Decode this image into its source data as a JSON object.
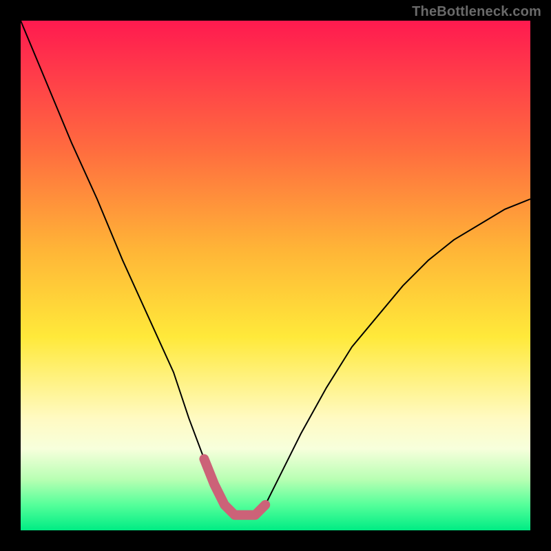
{
  "watermark": "TheBottleneck.com",
  "colors": {
    "background": "#000000",
    "gradient_top": "#ff1a4f",
    "gradient_bottom": "#00ec84",
    "curve": "#000000",
    "valley_highlight": "#cc6278"
  },
  "chart_data": {
    "type": "line",
    "title": "",
    "xlabel": "",
    "ylabel": "",
    "xlim": [
      0,
      100
    ],
    "ylim": [
      0,
      100
    ],
    "grid": false,
    "legend": false,
    "annotations": [],
    "series": [
      {
        "name": "bottleneck-curve",
        "x": [
          0,
          5,
          10,
          15,
          20,
          25,
          30,
          33,
          36,
          38,
          40,
          42,
          44,
          46,
          48,
          50,
          55,
          60,
          65,
          70,
          75,
          80,
          85,
          90,
          95,
          100
        ],
        "values": [
          100,
          88,
          76,
          65,
          53,
          42,
          31,
          22,
          14,
          9,
          5,
          3,
          3,
          3,
          5,
          9,
          19,
          28,
          36,
          42,
          48,
          53,
          57,
          60,
          63,
          65
        ]
      }
    ],
    "valley_highlight_xrange": [
      36,
      48
    ]
  }
}
